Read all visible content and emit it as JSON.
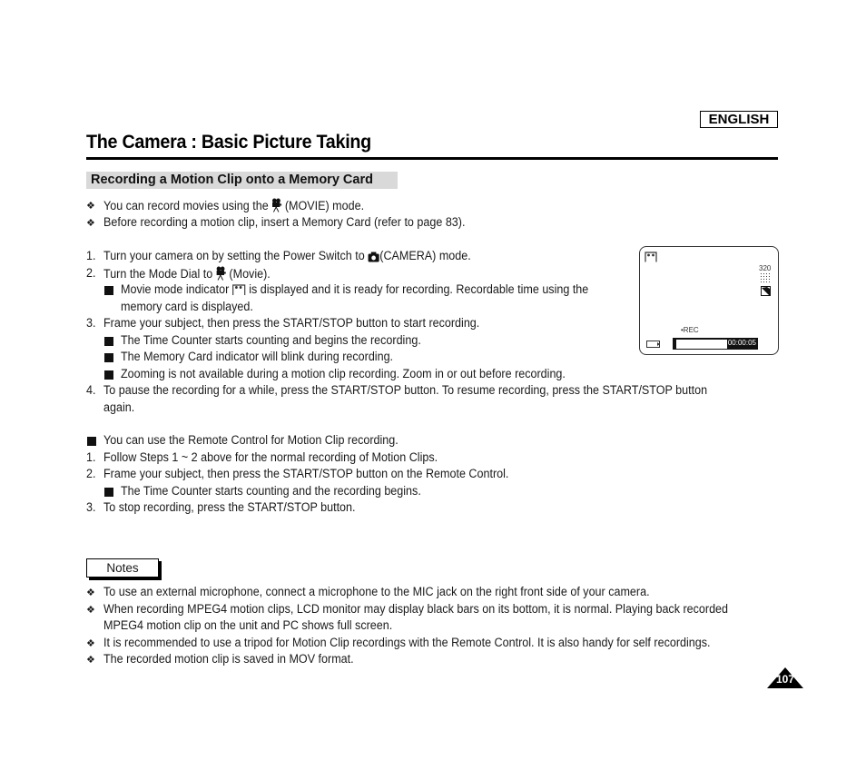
{
  "header": {
    "language": "ENGLISH",
    "title": "The Camera : Basic Picture Taking"
  },
  "section": {
    "heading": "Recording a Motion Clip onto a Memory Card"
  },
  "intro_bullets": [
    {
      "before": "You can record movies using the",
      "icon": "movie-camera-icon",
      "after": "(MOVIE) mode."
    },
    {
      "text": "Before recording a motion clip, insert a Memory Card (refer to page 83)."
    }
  ],
  "steps": [
    {
      "num": "1.",
      "before": "Turn your camera on by setting the Power Switch to",
      "icon": "camera-icon",
      "after": "(CAMERA) mode."
    },
    {
      "num": "2.",
      "before": "Turn the Mode Dial to",
      "icon": "movie-camera-icon",
      "after": "(Movie)."
    },
    {
      "sub": true,
      "before": "Movie mode indicator",
      "icon": "movie-mode-indicator-icon",
      "after": "is displayed and it is ready for recording. Recordable time using the",
      "cont": "memory card is displayed."
    },
    {
      "num": "3.",
      "text": "Frame your subject, then press the START/STOP button to start recording."
    },
    {
      "sub": true,
      "text": "The Time Counter starts counting and begins the recording."
    },
    {
      "sub": true,
      "text": "The Memory Card indicator will blink during recording."
    },
    {
      "sub": true,
      "text": "Zooming is not available during a motion clip recording. Zoom in or out before recording."
    },
    {
      "num": "4.",
      "text": "To pause the recording for a while, press the START/STOP button. To resume recording, press the START/STOP button",
      "cont": "again."
    }
  ],
  "remote": {
    "intro": "You can use the Remote Control for Motion Clip recording.",
    "steps": [
      {
        "num": "1.",
        "text": "Follow Steps 1 ~ 2 above for the normal recording of Motion Clips."
      },
      {
        "num": "2.",
        "text": "Frame your subject, then press the START/STOP button on the Remote Control."
      },
      {
        "sub": true,
        "text": "The Time Counter starts counting and the recording begins."
      },
      {
        "num": "3.",
        "text": "To stop recording, press the START/STOP button."
      }
    ]
  },
  "lcd": {
    "resolution": "320",
    "rec_label": "•REC",
    "time_counter": "00:00:05",
    "recording_progress": 0.03
  },
  "notes": {
    "label": "Notes",
    "items": [
      {
        "text": "To use an external microphone, connect a microphone to the MIC jack on the right front side of your camera."
      },
      {
        "text": "When recording MPEG4 motion clips, LCD monitor may display black bars on its bottom, it is normal. Playing back recorded",
        "cont": "MPEG4 motion clip on the unit and PC shows full screen."
      },
      {
        "text": "It is recommended to use a tripod for Motion Clip recordings with the Remote Control. It is also handy for self recordings."
      },
      {
        "text": "The recorded motion clip is saved in MOV format."
      }
    ]
  },
  "footer": {
    "page_number": "107"
  },
  "glyphs": {
    "diamond_bullet": "❖"
  }
}
